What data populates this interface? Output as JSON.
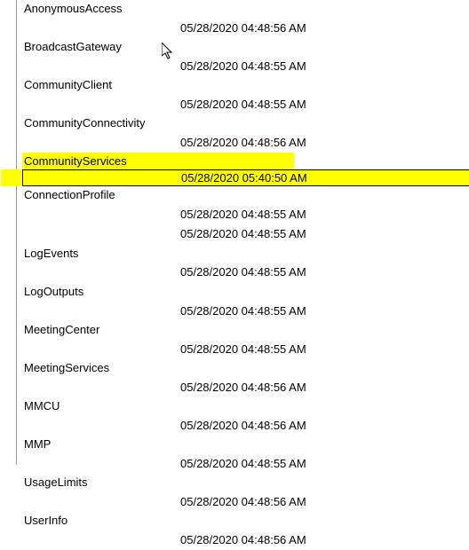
{
  "items": [
    {
      "label": "AnonymousAccess",
      "date": "05/28/2020 04:48:56 AM"
    },
    {
      "label": "BroadcastGateway",
      "date": "05/28/2020 04:48:55 AM"
    },
    {
      "label": "CommunityClient",
      "date": "05/28/2020 04:48:55 AM"
    },
    {
      "label": "CommunityConnectivity",
      "date": "05/28/2020 04:48:56 AM"
    },
    {
      "label": "CommunityServices",
      "date": "05/28/2020 05:40:50 AM",
      "highlighted": true
    },
    {
      "label": "ConnectionProfile",
      "dates": [
        "05/28/2020 04:48:55 AM",
        "05/28/2020 04:48:55 AM"
      ]
    },
    {
      "label": "LogEvents",
      "date": "05/28/2020 04:48:55 AM"
    },
    {
      "label": "LogOutputs",
      "date": "05/28/2020 04:48:55 AM"
    },
    {
      "label": "MeetingCenter",
      "date": "05/28/2020 04:48:55 AM"
    },
    {
      "label": "MeetingServices",
      "date": "05/28/2020 04:48:56 AM"
    },
    {
      "label": "MMCU",
      "date": "05/28/2020 04:48:56 AM"
    },
    {
      "label": "MMP",
      "date": "05/28/2020 04:48:55 AM"
    },
    {
      "label": "UsageLimits",
      "date": "05/28/2020 04:48:56 AM"
    },
    {
      "label": "UserInfo",
      "date": "05/28/2020 04:48:56 AM"
    }
  ]
}
